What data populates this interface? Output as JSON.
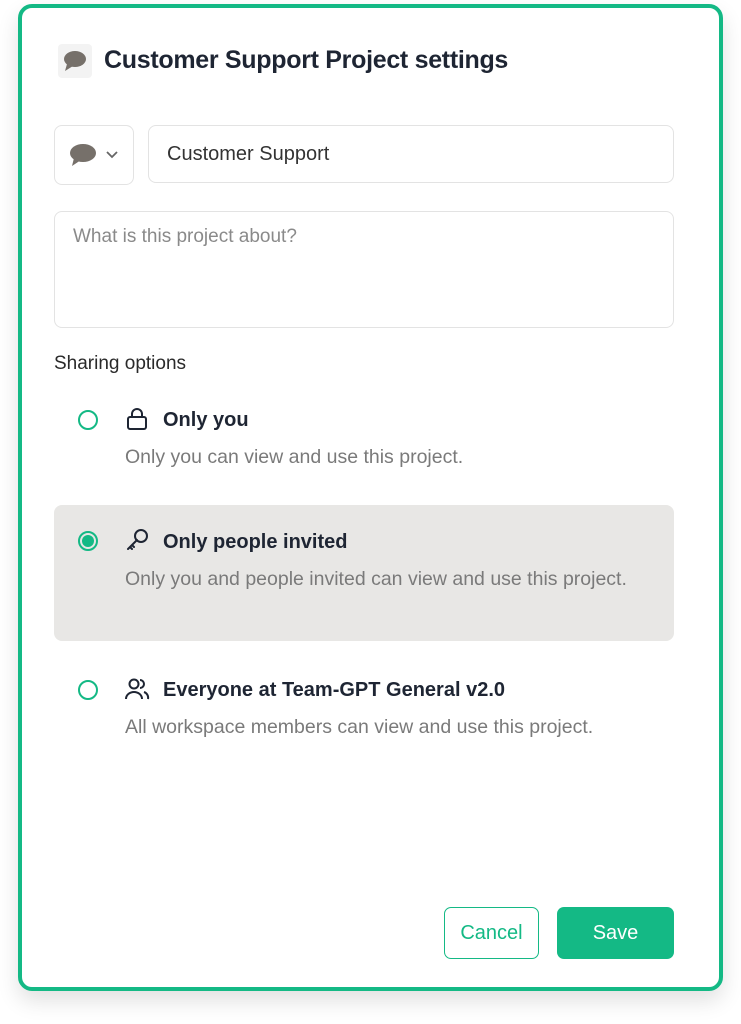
{
  "dialog": {
    "title": "Customer Support Project settings",
    "title_icon": "speech-bubble-icon",
    "project_icon": "speech-bubble-icon",
    "name_value": "Customer Support",
    "description_value": "",
    "description_placeholder": "What is this project about?",
    "sharing_label": "Sharing options",
    "options": [
      {
        "icon": "lock-icon",
        "title": "Only you",
        "description": "Only you can view and use this project.",
        "selected": false
      },
      {
        "icon": "key-icon",
        "title": "Only people invited",
        "description": "Only you and people invited can view and use this project.",
        "selected": true
      },
      {
        "icon": "users-icon",
        "title": "Everyone at Team-GPT General v2.0",
        "description": "All workspace members can view and use this project.",
        "selected": false
      }
    ],
    "cancel_label": "Cancel",
    "save_label": "Save"
  },
  "colors": {
    "accent": "#14b985",
    "selected_bg": "#e8e7e5",
    "text": "#1e2533",
    "muted": "#7a7a7a"
  }
}
